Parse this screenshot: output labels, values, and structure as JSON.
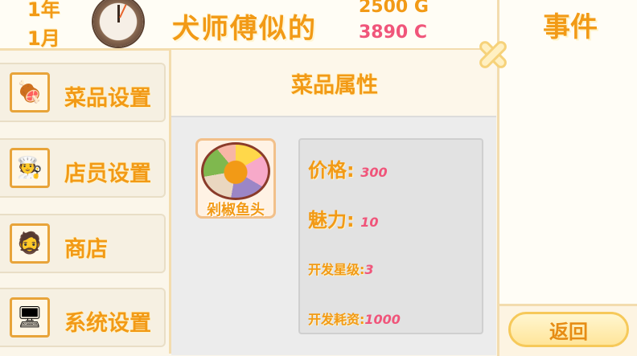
{
  "header": {
    "year": "1年",
    "month": "1月",
    "shop_name": "犬师傅似的",
    "gold": "2500 G",
    "coins": "3890 C"
  },
  "events": {
    "title": "事件"
  },
  "back_button": {
    "label": "返回"
  },
  "menu": {
    "items": [
      {
        "label": "菜品设置",
        "icon": "dish-icon"
      },
      {
        "label": "店员设置",
        "icon": "staff-icon"
      },
      {
        "label": "商店",
        "icon": "shop-icon"
      },
      {
        "label": "系统设置",
        "icon": "computer-icon"
      }
    ]
  },
  "panel": {
    "title": "菜品属性",
    "dish_name": "剁椒鱼头",
    "attributes": {
      "price_label": "价格:",
      "price_value": "300",
      "charm_label": "魅力:",
      "charm_value": "10",
      "star_label": "开发星级:",
      "star_value": "3",
      "cost_label": "开发耗资:",
      "cost_value": "1000"
    }
  },
  "colors": {
    "accent": "#f29a16",
    "value": "#f0557a",
    "border": "#f3dcae"
  }
}
